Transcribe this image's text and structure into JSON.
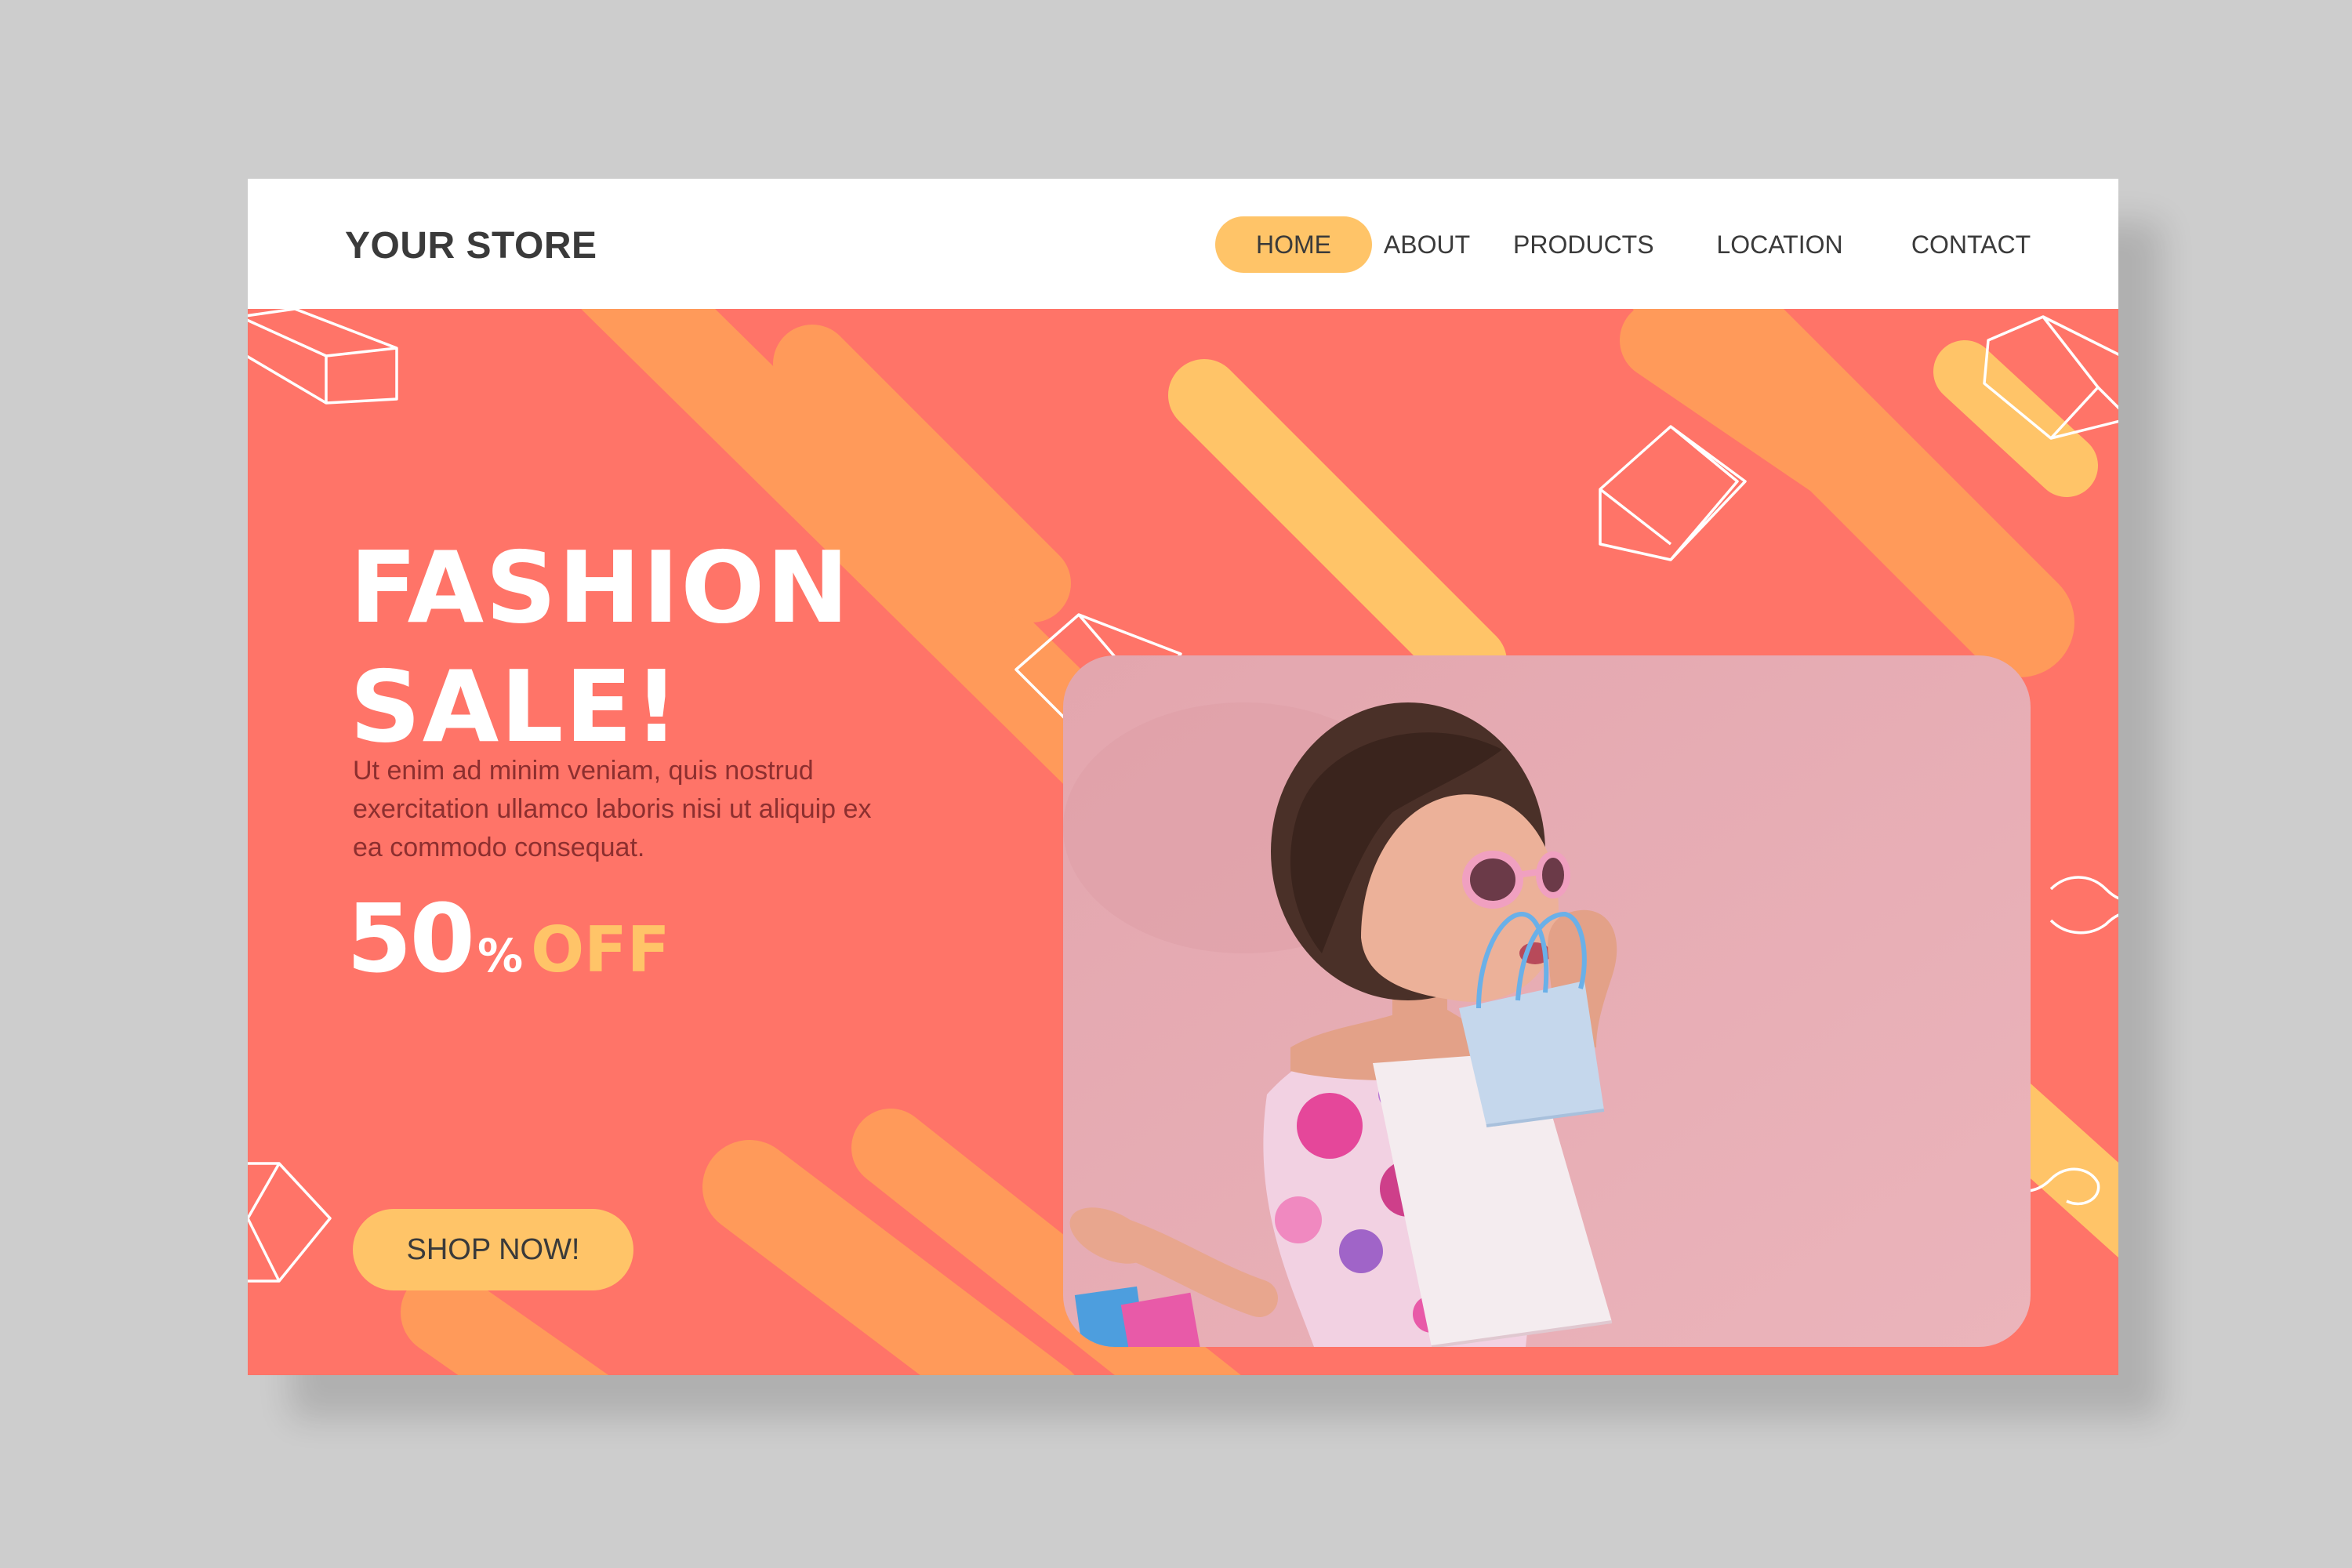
{
  "brand": "YOUR STORE",
  "nav": {
    "items": [
      {
        "label": "HOME",
        "active": true
      },
      {
        "label": "ABOUT",
        "active": false
      },
      {
        "label": "PRODUCTS",
        "active": false
      },
      {
        "label": "LOCATION",
        "active": false
      },
      {
        "label": "CONTACT",
        "active": false
      }
    ]
  },
  "hero": {
    "headline": "FASHION\nSALE!",
    "description": "Ut enim ad minim veniam, quis nostrud exercitation ullamco laboris nisi ut aliquip ex ea commodo consequat.",
    "discount": {
      "value": "50",
      "unit": "%",
      "suffix": "OFF"
    },
    "cta_label": "SHOP NOW!"
  },
  "colors": {
    "background": "#cdcdcd",
    "hero": "#ff7468",
    "accent_yellow": "#ffc468",
    "accent_orange": "#ff9a5a",
    "text_dark": "#3a3a3a",
    "photo_wall": "#e8aab4"
  },
  "icons": [
    "cube-outline-icon",
    "wavy-line-icon",
    "rounded-stripe-shape"
  ]
}
